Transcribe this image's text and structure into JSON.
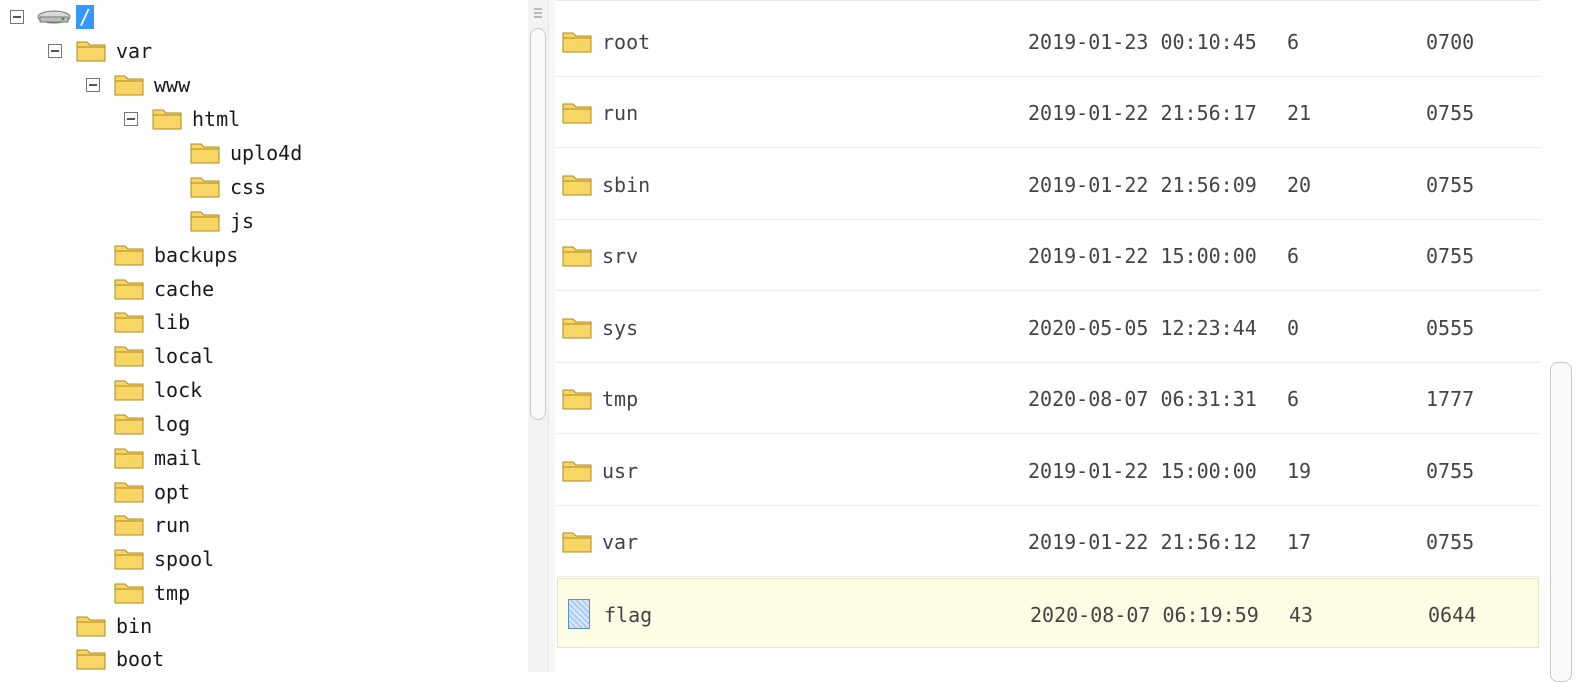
{
  "tree": {
    "root_label": "/",
    "nodes": [
      {
        "label": "var",
        "expanded": true
      },
      {
        "label": "www",
        "expanded": true
      },
      {
        "label": "html",
        "expanded": true
      },
      {
        "label": "uplo4d"
      },
      {
        "label": "css"
      },
      {
        "label": "js"
      },
      {
        "label": "backups"
      },
      {
        "label": "cache"
      },
      {
        "label": "lib"
      },
      {
        "label": "local"
      },
      {
        "label": "lock"
      },
      {
        "label": "log"
      },
      {
        "label": "mail"
      },
      {
        "label": "opt"
      },
      {
        "label": "run"
      },
      {
        "label": "spool"
      },
      {
        "label": "tmp"
      },
      {
        "label": "bin"
      },
      {
        "label": "boot"
      }
    ]
  },
  "files": [
    {
      "name": "root",
      "type": "folder",
      "date": "2019-01-23 00:10:45",
      "size": "6",
      "perm": "0700"
    },
    {
      "name": "run",
      "type": "folder",
      "date": "2019-01-22 21:56:17",
      "size": "21",
      "perm": "0755"
    },
    {
      "name": "sbin",
      "type": "folder",
      "date": "2019-01-22 21:56:09",
      "size": "20",
      "perm": "0755"
    },
    {
      "name": "srv",
      "type": "folder",
      "date": "2019-01-22 15:00:00",
      "size": "6",
      "perm": "0755"
    },
    {
      "name": "sys",
      "type": "folder",
      "date": "2020-05-05 12:23:44",
      "size": "0",
      "perm": "0555"
    },
    {
      "name": "tmp",
      "type": "folder",
      "date": "2020-08-07 06:31:31",
      "size": "6",
      "perm": "1777"
    },
    {
      "name": "usr",
      "type": "folder",
      "date": "2019-01-22 15:00:00",
      "size": "19",
      "perm": "0755"
    },
    {
      "name": "var",
      "type": "folder",
      "date": "2019-01-22 21:56:12",
      "size": "17",
      "perm": "0755"
    },
    {
      "name": "flag",
      "type": "file",
      "date": "2020-08-07 06:19:59",
      "size": "43",
      "perm": "0644",
      "selected": true
    }
  ],
  "colors": {
    "selection": "#3399ff",
    "row_highlight": "#fdfde6",
    "folder_fill": "#f7d666"
  }
}
